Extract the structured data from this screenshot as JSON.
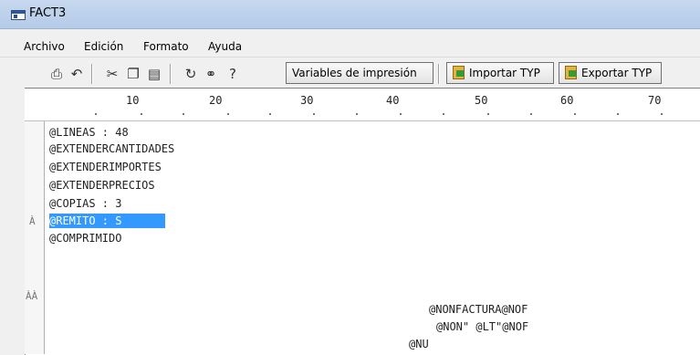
{
  "window": {
    "title": "FACT3"
  },
  "menu": [
    "Archivo",
    "Edición",
    "Formato",
    "Ayuda"
  ],
  "toolbar": {
    "icons": [
      "printer-icon",
      "undo-icon",
      "cut-icon",
      "copy-icon",
      "paste-icon",
      "find-icon",
      "binoculars-icon",
      "help-icon"
    ],
    "variables_label": "Variables de impresión",
    "import_label": "Importar TYP",
    "export_label": "Exportar TYP"
  },
  "ruler": {
    "marks": [
      "10",
      "20",
      "30",
      "40",
      "50",
      "60",
      "70"
    ]
  },
  "gutter": [
    "À",
    "ÀÀ"
  ],
  "editor": {
    "lines": [
      "@LINEAS : 48",
      "@EXTENDERCANTIDADES",
      "@EXTENDERIMPORTES",
      "@EXTENDERPRECIOS",
      "@COPIAS : 3",
      "@REMITO : S",
      "@COMPRIMIDO",
      "@NONFACTURA@NOF",
      "@NON\" @LT\"@NOF",
      "@NU"
    ],
    "selected_line": "@REMITO : S"
  }
}
